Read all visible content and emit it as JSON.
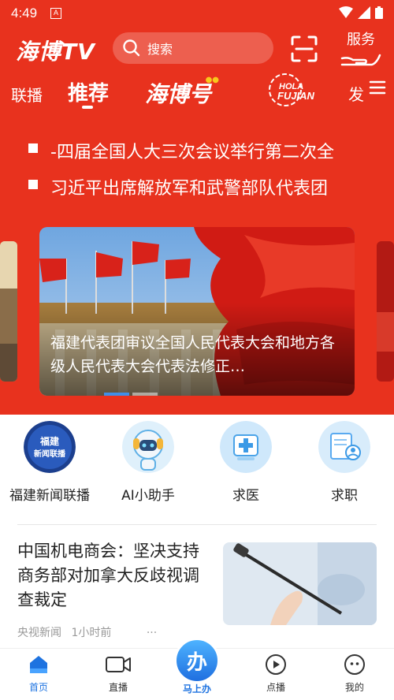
{
  "statusbar": {
    "time": "4:49",
    "sim_label": "A"
  },
  "header": {
    "logo": "海博TV",
    "search_placeholder": "搜索",
    "service_label": "服务"
  },
  "tabs": {
    "live": "联播",
    "recommend": "推荐",
    "haibo": "海博号",
    "hola_line1": "HOLA",
    "hola_line2": "FUJIAN",
    "more": "发"
  },
  "ticker": [
    "-四届全国人大三次会议举行第二次全",
    "习近平出席解放军和武警部队代表团"
  ],
  "banner": {
    "caption": "福建代表团审议全国人民代表大会和地方各级人民代表大会代表法修正…"
  },
  "quick_links": [
    {
      "label": "福建新闻联播",
      "icon_text": "福建 新闻联播"
    },
    {
      "label": "AI小助手"
    },
    {
      "label": "求医"
    },
    {
      "label": "求职"
    }
  ],
  "news": {
    "title": "中国机电商会：坚决支持商务部对加拿大反歧视调查裁定",
    "source": "央视新闻",
    "time": "1小时前",
    "more": "···"
  },
  "bottom_nav": {
    "home": "首页",
    "live": "直播",
    "center": "马上办",
    "center_badge": "办",
    "vod": "点播",
    "mine": "我的"
  },
  "colors": {
    "brand_red": "#e8321e",
    "accent_blue": "#1e73e0"
  }
}
